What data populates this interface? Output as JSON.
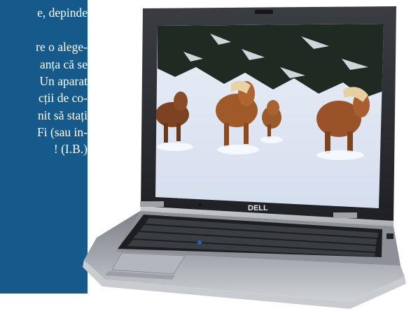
{
  "sidebar": {
    "text_lines": [
      "e, depinde",
      "re o alege-",
      "anța că se",
      "Un aparat",
      "cții de co-",
      "nit să stați",
      "Fi (sau in-",
      "! (I.B.)"
    ]
  },
  "laptop": {
    "logo": "DELL",
    "screen_scene": "horses-running-in-snow"
  },
  "colors": {
    "sidebar": "#155a8a",
    "text": "#ffffff"
  }
}
